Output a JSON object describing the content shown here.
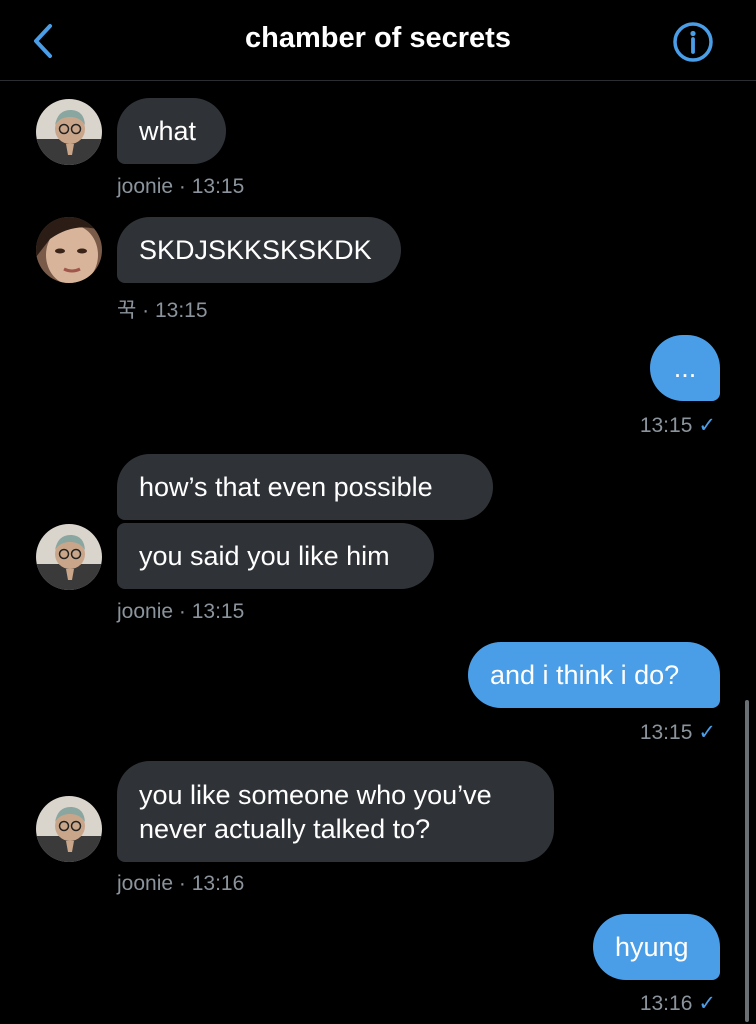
{
  "header": {
    "title": "chamber of secrets",
    "back_icon": "chevron-left-icon",
    "info_icon": "info-circle-icon",
    "accent_color": "#4a9ee8"
  },
  "messages": [
    {
      "side": "incoming",
      "text": "what",
      "sender": "joonie",
      "time": "13:15",
      "meta": "joonie · 13:15",
      "avatar": "avatar-joonie"
    },
    {
      "side": "incoming",
      "text": "SKDJSKKSKSKDK",
      "sender": "꾹",
      "time": "13:15",
      "meta": "꾹 · 13:15",
      "avatar": "avatar-kook"
    },
    {
      "side": "outgoing",
      "text": "...",
      "time": "13:15",
      "meta": "13:15"
    },
    {
      "side": "incoming",
      "text": "how’s that even possible",
      "sender": "joonie"
    },
    {
      "side": "incoming",
      "text": "you said you like him",
      "sender": "joonie",
      "time": "13:15",
      "meta": "joonie · 13:15",
      "avatar": "avatar-joonie"
    },
    {
      "side": "outgoing",
      "text": "and i think i do?",
      "time": "13:15",
      "meta": "13:15"
    },
    {
      "side": "incoming",
      "text_line1": "you like someone who you’ve",
      "text_line2": "never actually talked to?",
      "sender": "joonie",
      "time": "13:16",
      "meta": "joonie · 13:16",
      "avatar": "avatar-joonie"
    },
    {
      "side": "outgoing",
      "text": "hyung",
      "time": "13:16",
      "meta": "13:16"
    }
  ],
  "colors": {
    "incoming_bubble": "#2f3337",
    "outgoing_bubble": "#4a9ee8",
    "meta_text": "#8b949c",
    "background": "#000000"
  },
  "read_icon": "checkmark-icon"
}
